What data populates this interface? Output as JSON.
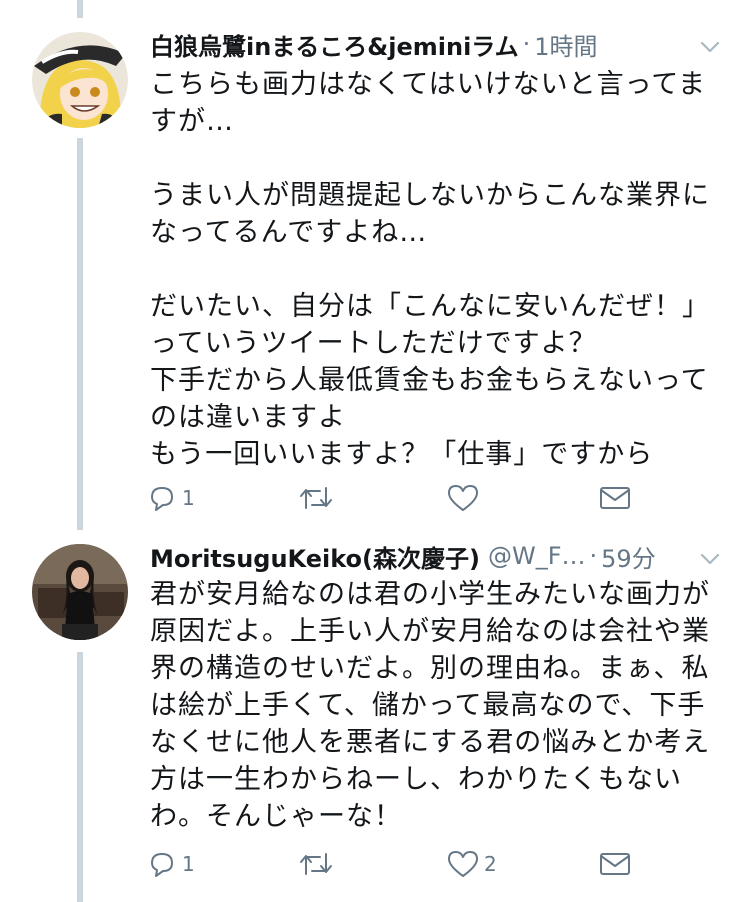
{
  "tweets": [
    {
      "display_name": "白狼烏鷺inまるころ&jeminiラム",
      "handle": "",
      "separator": "·",
      "time": "1時間",
      "text": "こちらも画力はなくてはいけないと言ってま\nすが…\n\nうまい人が問題提起しないからこんな業界に\nなってるんですよね…\n\nだいたい、自分は「こんなに安いんだぜ！」\nっていうツイートしただけですよ？\n下手だから人最低賃金もお金もらえないって\nのは違いますよ\nもう一回いいますよ？「仕事」ですから",
      "reply_count": "1",
      "retweet_count": "",
      "like_count": ""
    },
    {
      "display_name": "MoritsuguKeiko(森次慶子)",
      "handle": "@W_F…",
      "separator": "·",
      "time": "59分",
      "text": "君が安月給なのは君の小学生みたいな画力が\n原因だよ。上手い人が安月給なのは会社や業\n界の構造のせいだよ。別の理由ね。まぁ、私\nは絵が上手くて、儲かって最高なので、下手\nなくせに他人を悪者にする君の悩みとか考え\n方は一生わからねーし、わかりたくもない\nわ。そんじゃーな！",
      "reply_count": "1",
      "retweet_count": "",
      "like_count": "2"
    }
  ],
  "icons": [
    "reply-icon",
    "retweet-icon",
    "like-icon",
    "direct-message-icon",
    "caret-down-icon"
  ],
  "colors": {
    "text": "#14171a",
    "secondary": "#657786",
    "thread_line": "#ccd6dd"
  }
}
